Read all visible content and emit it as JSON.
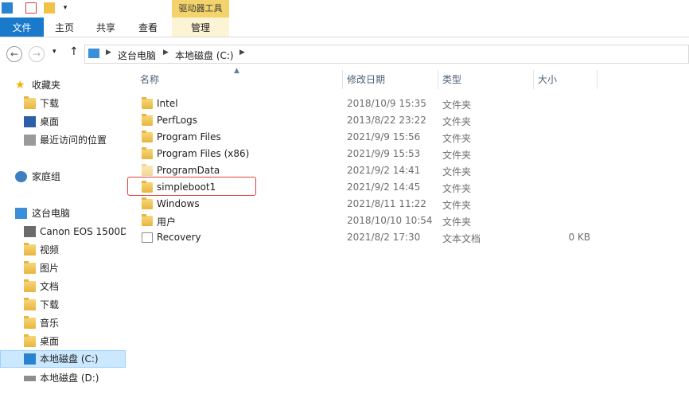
{
  "window": {
    "contextual_tab_title": "驱动器工具"
  },
  "ribbon": {
    "tabs": [
      {
        "label": "文件"
      },
      {
        "label": "主页"
      },
      {
        "label": "共享"
      },
      {
        "label": "查看"
      },
      {
        "label": "管理"
      }
    ]
  },
  "address": {
    "breadcrumbs": [
      "这台电脑",
      "本地磁盘 (C:)"
    ]
  },
  "nav": {
    "items": [
      {
        "label": "收藏夹",
        "icon": "star-icon"
      },
      {
        "label": "下载",
        "icon": "download-folder-icon"
      },
      {
        "label": "桌面",
        "icon": "desktop-icon"
      },
      {
        "label": "最近访问的位置",
        "icon": "recent-places-icon"
      },
      {
        "label": "家庭组",
        "icon": "homegroup-icon"
      },
      {
        "label": "这台电脑",
        "icon": "computer-icon"
      },
      {
        "label": "Canon EOS 1500D",
        "icon": "camera-icon"
      },
      {
        "label": "视频",
        "icon": "videos-folder-icon"
      },
      {
        "label": "图片",
        "icon": "pictures-folder-icon"
      },
      {
        "label": "文档",
        "icon": "documents-folder-icon"
      },
      {
        "label": "下载",
        "icon": "download-folder-icon"
      },
      {
        "label": "音乐",
        "icon": "music-folder-icon"
      },
      {
        "label": "桌面",
        "icon": "desktop-folder-icon"
      },
      {
        "label": "本地磁盘 (C:)",
        "icon": "drive-c-icon"
      },
      {
        "label": "本地磁盘 (D:)",
        "icon": "drive-d-icon"
      }
    ]
  },
  "list": {
    "columns": {
      "name": "名称",
      "date": "修改日期",
      "type": "类型",
      "size": "大小"
    },
    "rows": [
      {
        "name": "Intel",
        "date": "2018/10/9 15:35",
        "type": "文件夹",
        "size": ""
      },
      {
        "name": "PerfLogs",
        "date": "2013/8/22 23:22",
        "type": "文件夹",
        "size": ""
      },
      {
        "name": "Program Files",
        "date": "2021/9/9 15:56",
        "type": "文件夹",
        "size": ""
      },
      {
        "name": "Program Files (x86)",
        "date": "2021/9/9 15:53",
        "type": "文件夹",
        "size": ""
      },
      {
        "name": "ProgramData",
        "date": "2021/9/2 14:41",
        "type": "文件夹",
        "size": ""
      },
      {
        "name": "simpleboot1",
        "date": "2021/9/2 14:45",
        "type": "文件夹",
        "size": ""
      },
      {
        "name": "Windows",
        "date": "2021/8/11 11:22",
        "type": "文件夹",
        "size": ""
      },
      {
        "name": "用户",
        "date": "2018/10/10 10:54",
        "type": "文件夹",
        "size": ""
      },
      {
        "name": "Recovery",
        "date": "2021/8/2 17:30",
        "type": "文本文档",
        "size": "0 KB"
      }
    ]
  },
  "colors": {
    "accent": "#1979ca",
    "contextual": "#f3d36b",
    "highlight": "#e0403a",
    "selection": "#cce8ff"
  }
}
